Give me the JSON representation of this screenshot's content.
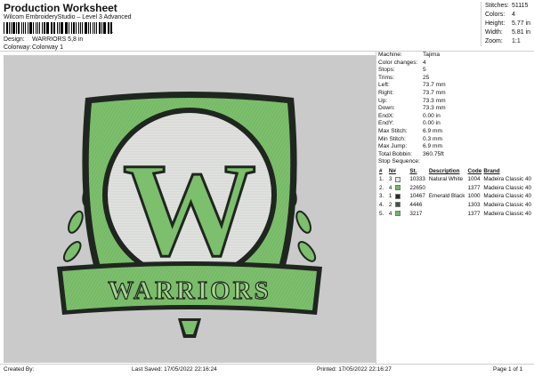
{
  "header": {
    "title": "Production Worksheet",
    "subtitle": "Wilcom EmbroideryStudio – Level 3 Advanced",
    "barcode_number": "1",
    "design_label": "Design:",
    "design_value": "WARRIORS 5,8 in",
    "colorway_label": "Colorway:",
    "colorway_value": "Colorway 1"
  },
  "stats": [
    {
      "label": "Stitches:",
      "value": "51115"
    },
    {
      "label": "Colors:",
      "value": "4"
    },
    {
      "label": "Height:",
      "value": "5.77 in"
    },
    {
      "label": "Width:",
      "value": "5.81 in"
    },
    {
      "label": "Zoom:",
      "value": "1:1"
    }
  ],
  "details": [
    {
      "label": "Machine:",
      "value": "Tajima"
    },
    {
      "label": "Color changes:",
      "value": "4"
    },
    {
      "label": "Stops:",
      "value": "5"
    },
    {
      "label": "Trims:",
      "value": "25"
    },
    {
      "label": "Left:",
      "value": "73.7 mm"
    },
    {
      "label": "Right:",
      "value": "73.7 mm"
    },
    {
      "label": "Up:",
      "value": "73.3 mm"
    },
    {
      "label": "Down:",
      "value": "73.3 mm"
    },
    {
      "label": "EndX:",
      "value": "0.00 in"
    },
    {
      "label": "EndY:",
      "value": "0.00 in"
    },
    {
      "label": "Max Stitch:",
      "value": "6.9 mm"
    },
    {
      "label": "Min Stitch:",
      "value": "0.3 mm"
    },
    {
      "label": "Max Jump:",
      "value": "6.9 mm"
    },
    {
      "label": "Total Bobbin:",
      "value": "360.75ft"
    }
  ],
  "stop_sequence": {
    "title": "Stop Sequence:",
    "columns": [
      "#",
      "N#",
      "St.",
      "Description",
      "Code",
      "Brand"
    ],
    "rows": [
      {
        "num": "1.",
        "needle": "3",
        "color": "#e6e6e6",
        "stitches": "10333",
        "description": "Natural White",
        "code": "1004",
        "brand": "Madeira Classic 40"
      },
      {
        "num": "2.",
        "needle": "4",
        "color": "#6db96a",
        "stitches": "22650",
        "description": "",
        "code": "1377",
        "brand": "Madeira Classic 40"
      },
      {
        "num": "3.",
        "needle": "1",
        "color": "#252a25",
        "stitches": "10467",
        "description": "Emerald Black",
        "code": "1000",
        "brand": "Madeira Classic 40"
      },
      {
        "num": "4.",
        "needle": "2",
        "color": "#3a5a3a",
        "stitches": "4446",
        "description": "",
        "code": "1303",
        "brand": "Madeira Classic 40"
      },
      {
        "num": "5.",
        "needle": "4",
        "color": "#6db96a",
        "stitches": "3217",
        "description": "",
        "code": "1377",
        "brand": "Madeira Classic 40"
      }
    ]
  },
  "design": {
    "letter": "W",
    "banner_text": "WARRIORS",
    "colors": {
      "background": "#cacaca",
      "green": "#7cbf6c",
      "light_green": "#a3d58f",
      "dark": "#1f261f",
      "white": "#dfe0de"
    }
  },
  "footer": {
    "created_by": "Created By:",
    "last_saved": "Last Saved: 17/05/2022 22:16:24",
    "printed": "Printed: 17/05/2022 22:16:27",
    "page": "Page 1 of 1"
  }
}
